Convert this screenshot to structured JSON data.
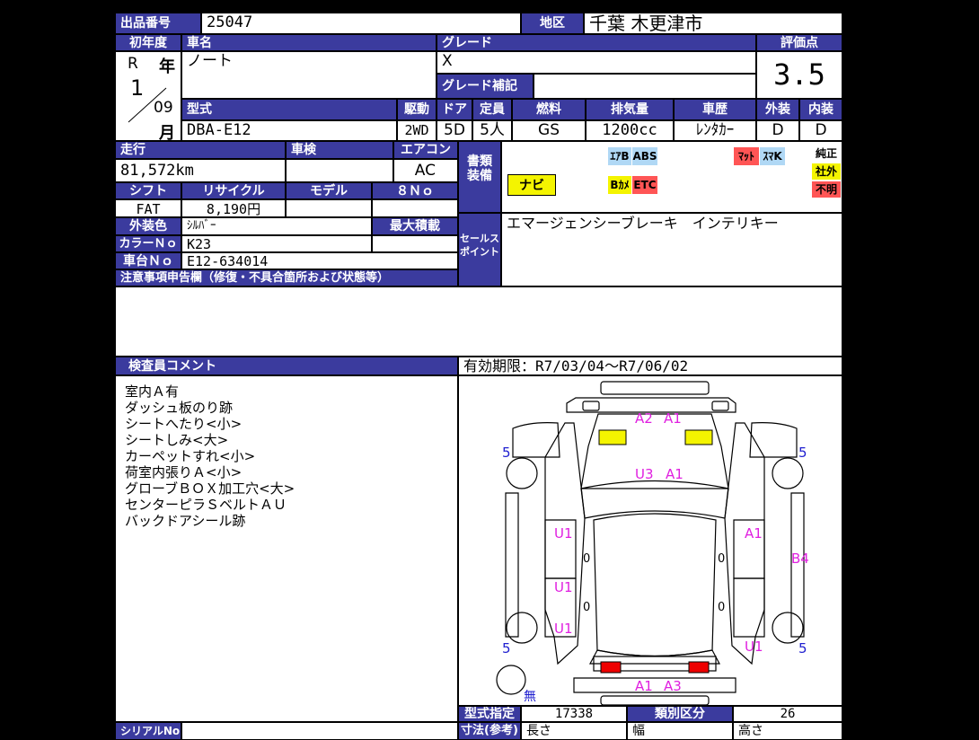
{
  "header": {
    "lot_label": "出品番号",
    "lot_no": "25047",
    "region_label": "地区",
    "region": "千葉 木更津市"
  },
  "row2": {
    "year_label": "初年度",
    "car_label": "車名",
    "grade_label": "グレード",
    "score_label": "評価点",
    "era": "R",
    "year_unit": "年",
    "year": "1",
    "month": "09",
    "month_unit": "月",
    "car_name": "ノート",
    "grade": "X",
    "grade_note_label": "グレード補記",
    "score": "3.5"
  },
  "specs": {
    "labels": {
      "model": "型式",
      "drive": "駆動",
      "door": "ドア",
      "seats": "定員",
      "fuel": "燃料",
      "cc": "排気量",
      "history": "車歴",
      "exterior": "外装",
      "interior": "内装"
    },
    "model": "DBA-E12",
    "drive": "2WD",
    "door": "5D",
    "seats": "5人",
    "fuel": "GS",
    "cc": "1200cc",
    "history": "ﾚﾝﾀｶｰ",
    "exterior": "D",
    "interior": "D"
  },
  "info": {
    "mileage_label": "走行",
    "inspection_label": "車検",
    "aircon_label": "エアコン",
    "mileage": "81,572km",
    "inspection": "",
    "aircon": "AC",
    "shift_label": "シフト",
    "recycle_label": "リサイクル",
    "model_label": "モデル",
    "no8_label": "８Ｎｏ",
    "shift": "FAT",
    "recycle": "8,190円",
    "color_label": "外装色",
    "color": "ｼﾙﾊﾞｰ",
    "max_load_label": "最大積載",
    "colorno_label": "カラーＮｏ",
    "colorno": "K23",
    "chassis_label": "車台Ｎｏ",
    "chassis": "E12-634014",
    "notes_label": "注意事項申告欄（修復・不具合箇所および状態等）"
  },
  "equipment": {
    "label_line1": "書類",
    "label_line2": "装備",
    "tags": {
      "airbag": "ｴｱB",
      "abs": "ABS",
      "navi": "ナビ",
      "bcam": "Bｶﾒ",
      "etc": "ETC",
      "mat": "ﾏｯﾄ",
      "smartkey": "ｽﾏK",
      "genuine": "純正",
      "aftermarket": "社外",
      "unknown": "不明"
    }
  },
  "sales": {
    "label_line1": "セールス",
    "label_line2": "ポイント",
    "text": "エマージェンシーブレーキ　インテリキー"
  },
  "inspector": {
    "label": "検査員コメント",
    "lines": [
      "室内Ａ有",
      "ダッシュ板のり跡",
      "シートへたり<小>",
      "シートしみ<大>",
      "カーペットすれ<小>",
      "荷室内張りＡ<小>",
      "グローブＢＯＸ加工穴<大>",
      "センターピラＳベルトＡＵ",
      "バックドアシール跡"
    ]
  },
  "validity": "有効期限：R7/03/04～R7/06/02",
  "diagram_marks": {
    "a2": "A2",
    "a1_front": "A1",
    "u3": "U3",
    "a1_roof": "A1",
    "u1_left1": "U1",
    "a1_right": "A1",
    "b4": "B4",
    "u1_left2": "U1",
    "u1_left3": "U1",
    "u1_right": "U1",
    "a1_rear": "A1",
    "a3": "A3",
    "t5_1": "5",
    "t5_2": "5",
    "t5_3": "5",
    "t5_4": "5",
    "zero1": "0",
    "zero2": "0",
    "zero3": "0",
    "zero4": "0",
    "spare": "無"
  },
  "footer": {
    "type_label": "型式指定",
    "type_no": "17338",
    "class_label": "類別区分",
    "class_no": "26",
    "serial_label": "シリアルNo",
    "size_label": "寸法(参考)",
    "length_label": "長さ",
    "width_label": "幅",
    "height_label": "高さ"
  },
  "colors": {
    "header_blue": "#3b3b9e",
    "magenta": "#e020e0",
    "blue_text": "#2020d0",
    "tag_yellow": "#f4f400",
    "tag_red": "#f55",
    "tag_blue": "#b0d8f5"
  }
}
